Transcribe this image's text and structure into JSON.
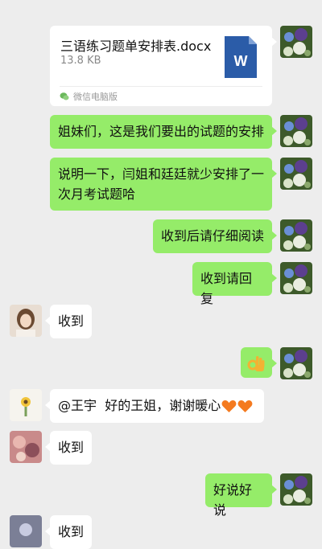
{
  "file_message": {
    "file_name": "三语练习题单安排表.docx",
    "file_size": "13.8 KB",
    "source": "微信电脑版",
    "file_type_letter": "W"
  },
  "messages": [
    {
      "sender": "me",
      "text": "姐妹们，这是我们要出的试题的安排"
    },
    {
      "sender": "me",
      "line1": "说明一下，闫姐和廷廷就少安排了一",
      "line2": "次月考试题哈"
    },
    {
      "sender": "me",
      "text": "收到后请仔细阅读"
    },
    {
      "sender": "me",
      "text": "收到请回复"
    },
    {
      "sender": "other",
      "text": "收到"
    },
    {
      "sender": "me",
      "emoji": "ok-hand-emoji"
    },
    {
      "sender": "other",
      "mention": "@王宇",
      "text": "好的王姐，谢谢暖心",
      "emoji": "orange-heart-emoji"
    },
    {
      "sender": "other",
      "text": "收到"
    },
    {
      "sender": "me",
      "text": "好说好说"
    },
    {
      "sender": "other",
      "text": "收到"
    }
  ],
  "colors": {
    "background": "#ededed",
    "my_bubble": "#95ec69",
    "other_bubble": "#ffffff",
    "word_icon": "#2b5ca8",
    "heart": "#f47a1f"
  }
}
